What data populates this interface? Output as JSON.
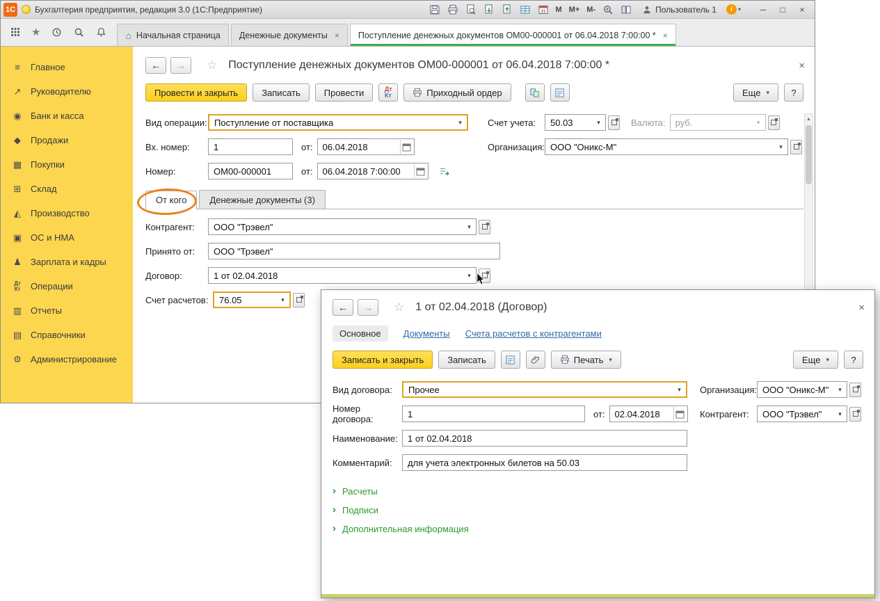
{
  "icons": {
    "dropdown": "▾",
    "back": "←",
    "forward": "→",
    "star": "☆",
    "star_filled": "★",
    "close": "×",
    "home": "⌂",
    "minimize": "─",
    "maximize": "□",
    "info": "i",
    "expander": "›",
    "scroll_up": "▲",
    "scroll_down": "▼"
  },
  "titlebar": {
    "logo": "1С",
    "title": "Бухгалтерия предприятия, редакция 3.0  (1С:Предприятие)",
    "memory": [
      "M",
      "M+",
      "M-"
    ],
    "user": "Пользователь 1"
  },
  "tabbar": {
    "tabs": [
      {
        "label": "Начальная страница"
      },
      {
        "label": "Денежные документы"
      },
      {
        "label": "Поступление денежных документов ОМ00-000001 от 06.04.2018 7:00:00 *"
      }
    ]
  },
  "sidebar": {
    "items": [
      {
        "label": "Главное",
        "glyph": "≡"
      },
      {
        "label": "Руководителю",
        "glyph": "↗"
      },
      {
        "label": "Банк и касса",
        "glyph": "◉"
      },
      {
        "label": "Продажи",
        "glyph": "◆"
      },
      {
        "label": "Покупки",
        "glyph": "▦"
      },
      {
        "label": "Склад",
        "glyph": "⊞"
      },
      {
        "label": "Производство",
        "glyph": "◭"
      },
      {
        "label": "ОС и НМА",
        "glyph": "▣"
      },
      {
        "label": "Зарплата и кадры",
        "glyph": "♟"
      },
      {
        "label": "Операции",
        "glyph_top": "Дт",
        "glyph_bottom": "Кт"
      },
      {
        "label": "Отчеты",
        "glyph": "▥"
      },
      {
        "label": "Справочники",
        "glyph": "▤"
      },
      {
        "label": "Администрирование",
        "glyph": "⚙"
      }
    ]
  },
  "doc": {
    "title": "Поступление денежных документов ОМ00-000001 от 06.04.2018 7:00:00 *",
    "toolbar": {
      "post_and_close": "Провести и закрыть",
      "save": "Записать",
      "post": "Провести",
      "dt": "Дт",
      "kt": "Кт",
      "cash_order": "Приходный ордер",
      "more": "Еще",
      "help": "?"
    },
    "fields": {
      "operation": {
        "label": "Вид операции:",
        "value": "Поступление от поставщика"
      },
      "account": {
        "label": "Счет учета:",
        "value": "50.03"
      },
      "currency": {
        "label": "Валюта:",
        "value": "руб."
      },
      "in_number": {
        "label": "Вх. номер:",
        "value": "1"
      },
      "in_date": {
        "label": "от:",
        "value": "06.04.2018"
      },
      "org": {
        "label": "Организация:",
        "value": "ООО \"Оникс-М\""
      },
      "number": {
        "label": "Номер:",
        "value": "ОМ00-000001"
      },
      "date": {
        "label": "от:",
        "value": "06.04.2018  7:00:00"
      },
      "counterparty": {
        "label": "Контрагент:",
        "value": "ООО \"Трэвел\""
      },
      "accepted_from": {
        "label": "Принято от:",
        "value": "ООО \"Трэвел\""
      },
      "contract": {
        "label": "Договор:",
        "value": "1 от 02.04.2018"
      },
      "settlement": {
        "label": "Счет расчетов:",
        "value": "76.05"
      }
    },
    "tabs": [
      {
        "label": "От кого"
      },
      {
        "label": "Денежные документы (3)"
      }
    ]
  },
  "dialog": {
    "title": "1 от 02.04.2018 (Договор)",
    "nav": [
      "Основное",
      "Документы",
      "Счета расчетов с контрагентами"
    ],
    "toolbar": {
      "save_and_close": "Записать и закрыть",
      "save": "Записать",
      "print": "Печать",
      "more": "Еще",
      "help": "?"
    },
    "fields": {
      "kind": {
        "label": "Вид договора:",
        "value": "Прочее"
      },
      "org": {
        "label": "Организация:",
        "value": "ООО \"Оникс-М\""
      },
      "number": {
        "label": "Номер договора:",
        "value": "1"
      },
      "date": {
        "label": "от:",
        "value": "02.04.2018"
      },
      "counterparty": {
        "label": "Контрагент:",
        "value": "ООО \"Трэвел\""
      },
      "name": {
        "label": "Наименование:",
        "value": "1 от 02.04.2018"
      },
      "comment": {
        "label": "Комментарий:",
        "value": "для учета электронных билетов на 50.03"
      }
    },
    "expanders": [
      "Расчеты",
      "Подписи",
      "Дополнительная информация"
    ]
  }
}
